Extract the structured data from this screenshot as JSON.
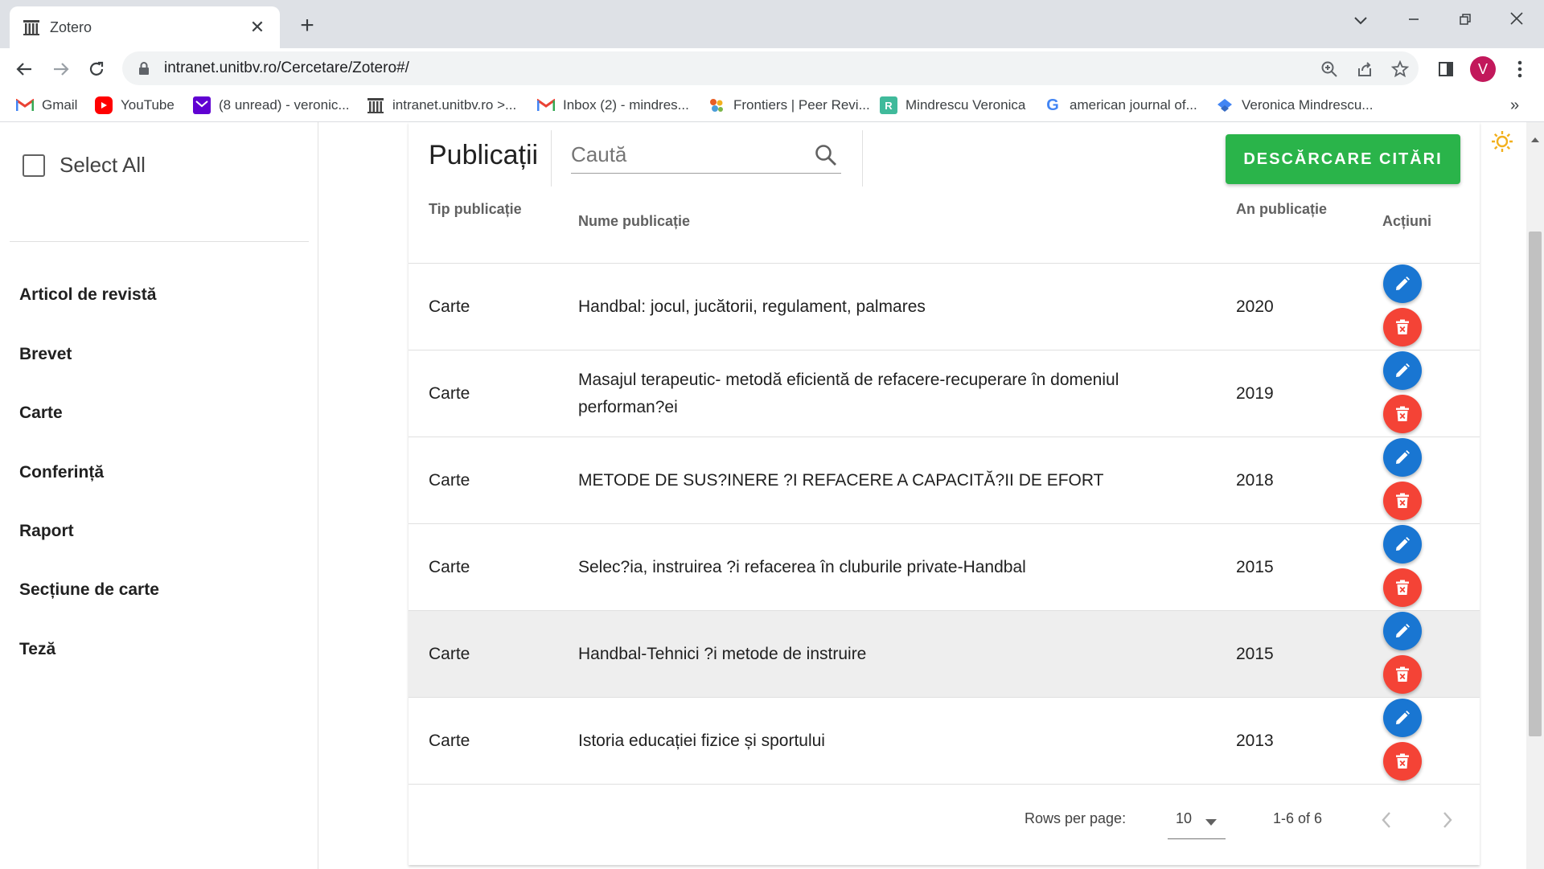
{
  "browser": {
    "tab_title": "Zotero",
    "url": "intranet.unitbv.ro/Cercetare/Zotero#/",
    "avatar_letter": "V",
    "bookmarks": [
      {
        "label": "Gmail",
        "icon": "gmail-icon"
      },
      {
        "label": "YouTube",
        "icon": "youtube-icon"
      },
      {
        "label": "(8 unread) - veronic...",
        "icon": "yahoo-mail-icon"
      },
      {
        "label": "intranet.unitbv.ro >...",
        "icon": "unitbv-icon"
      },
      {
        "label": "Inbox (2) - mindres...",
        "icon": "gmail-icon"
      },
      {
        "label": "Frontiers | Peer Revi...",
        "icon": "frontiers-icon"
      },
      {
        "label": "Mindrescu Veronica",
        "icon": "researchgate-icon"
      },
      {
        "label": "american journal of...",
        "icon": "google-icon"
      },
      {
        "label": "Veronica Mindrescu...",
        "icon": "scholar-icon"
      }
    ]
  },
  "sidebar": {
    "select_all_label": "Select All",
    "items": [
      {
        "label": "Articol de revistă"
      },
      {
        "label": "Brevet"
      },
      {
        "label": "Carte"
      },
      {
        "label": "Conferință"
      },
      {
        "label": "Raport"
      },
      {
        "label": "Secțiune de carte"
      },
      {
        "label": "Teză"
      }
    ]
  },
  "header": {
    "title": "Publicații",
    "search_placeholder": "Caută",
    "download_label": "DESCĂRCARE CITĂRI"
  },
  "table": {
    "columns": {
      "type": "Tip publicație",
      "name": "Nume publicație",
      "year": "An publicație",
      "actions": "Acțiuni"
    },
    "rows": [
      {
        "type": "Carte",
        "name": "Handbal: jocul, jucătorii, regulament, palmares",
        "year": "2020"
      },
      {
        "type": "Carte",
        "name": "Masajul terapeutic- metodă eficientă de refacere-recuperare în domeniul performan?ei",
        "year": "2019"
      },
      {
        "type": "Carte",
        "name": "METODE DE SUS?INERE ?I REFACERE A CAPACITĂ?II DE EFORT",
        "year": "2018"
      },
      {
        "type": "Carte",
        "name": "Selec?ia, instruirea ?i refacerea în cluburile private-Handbal",
        "year": "2015"
      },
      {
        "type": "Carte",
        "name": "Handbal-Tehnici ?i metode de instruire",
        "year": "2015"
      },
      {
        "type": "Carte",
        "name": "Istoria educației fizice și sportului",
        "year": "2013"
      }
    ]
  },
  "pagination": {
    "rows_per_page_label": "Rows per page:",
    "rows_per_page_value": "10",
    "range": "1-6 of 6"
  },
  "colors": {
    "download": "#2ab44a",
    "edit": "#1976d2",
    "delete": "#f44336"
  }
}
